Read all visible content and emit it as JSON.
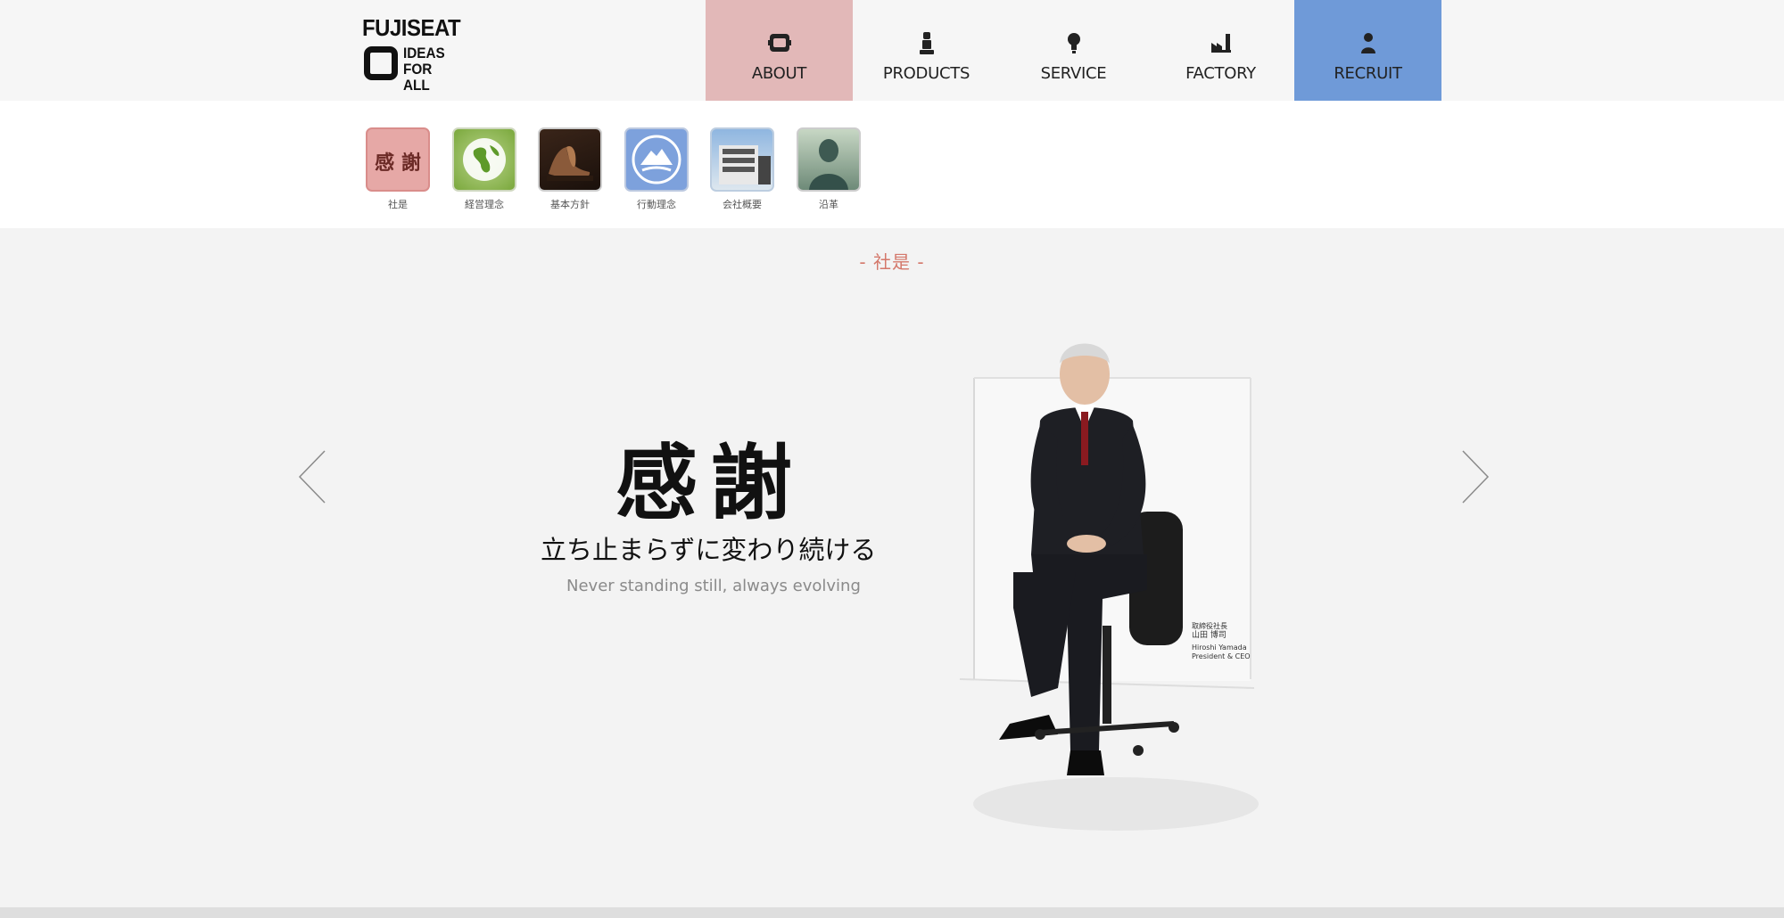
{
  "logo": {
    "top": "FUJISEAT",
    "line1": "IDEAS",
    "line2": "FOR ALL"
  },
  "nav": [
    {
      "label": "ABOUT",
      "icon": "seat-frame-icon",
      "color": "#e2b8b8"
    },
    {
      "label": "PRODUCTS",
      "icon": "seat-icon"
    },
    {
      "label": "SERVICE",
      "icon": "lightbulb-icon"
    },
    {
      "label": "FACTORY",
      "icon": "factory-icon"
    },
    {
      "label": "RECRUIT",
      "icon": "person-icon",
      "color": "#6f9ad8"
    }
  ],
  "subnav": [
    {
      "label": "社是",
      "icon": "kansha-calligraphy-icon"
    },
    {
      "label": "経営理念",
      "icon": "globe-icon"
    },
    {
      "label": "基本方針",
      "icon": "car-seat-icon"
    },
    {
      "label": "行動理念",
      "icon": "mountain-emblem-icon"
    },
    {
      "label": "会社概要",
      "icon": "office-building-icon"
    },
    {
      "label": "沿革",
      "icon": "bust-statue-icon"
    }
  ],
  "section_title": "- 社是 -",
  "motto": {
    "kanji": "感謝",
    "japanese": "立ち止まらずに変わり続ける",
    "english": "Never standing still, always evolving"
  },
  "photo_caption": {
    "title_jp": "取締役社長",
    "name_jp": "山田 博司",
    "name_en": "Hiroshi Yamada",
    "title_en": "President & CEO"
  },
  "colors": {
    "accent_red": "#d4776a",
    "about_bg": "#e2b8b8",
    "recruit_bg": "#6f9ad8"
  }
}
